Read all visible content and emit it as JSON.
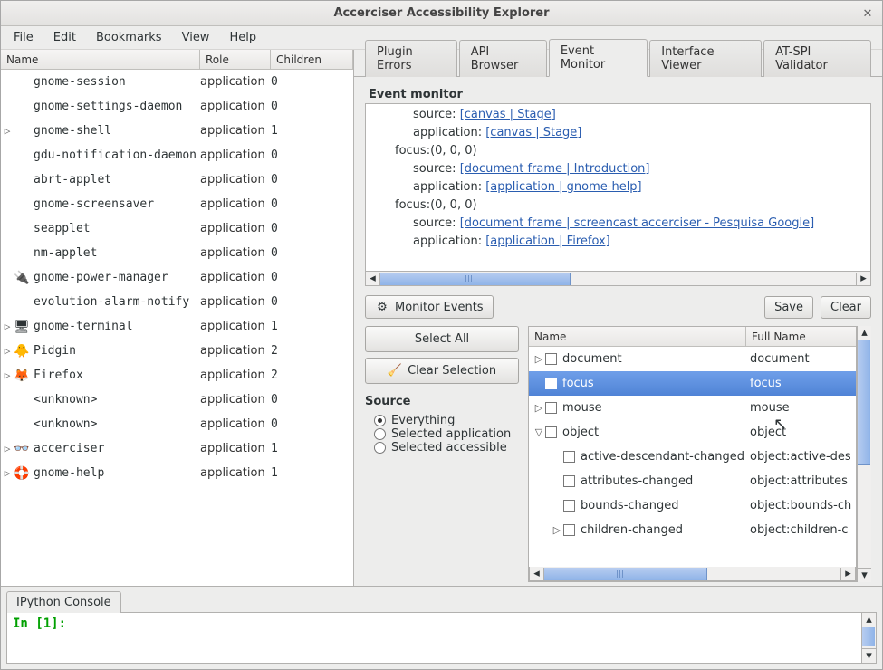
{
  "window": {
    "title": "Accerciser Accessibility Explorer"
  },
  "menubar": [
    "File",
    "Edit",
    "Bookmarks",
    "View",
    "Help"
  ],
  "left_tree": {
    "headers": {
      "name": "Name",
      "role": "Role",
      "children": "Children"
    },
    "rows": [
      {
        "exp": "",
        "icon": "",
        "name": "gnome-session",
        "role": "application",
        "children": "0"
      },
      {
        "exp": "",
        "icon": "",
        "name": "gnome-settings-daemon",
        "role": "application",
        "children": "0"
      },
      {
        "exp": "▷",
        "icon": "",
        "name": "gnome-shell",
        "role": "application",
        "children": "1"
      },
      {
        "exp": "",
        "icon": "",
        "name": "gdu-notification-daemon",
        "role": "application",
        "children": "0"
      },
      {
        "exp": "",
        "icon": "",
        "name": "abrt-applet",
        "role": "application",
        "children": "0"
      },
      {
        "exp": "",
        "icon": "",
        "name": "gnome-screensaver",
        "role": "application",
        "children": "0"
      },
      {
        "exp": "",
        "icon": "",
        "name": "seapplet",
        "role": "application",
        "children": "0"
      },
      {
        "exp": "",
        "icon": "",
        "name": "nm-applet",
        "role": "application",
        "children": "0"
      },
      {
        "exp": "",
        "icon": "🔌",
        "name": "gnome-power-manager",
        "role": "application",
        "children": "0"
      },
      {
        "exp": "",
        "icon": "",
        "name": "evolution-alarm-notify",
        "role": "application",
        "children": "0"
      },
      {
        "exp": "▷",
        "icon": "🖥",
        "name": "gnome-terminal",
        "role": "application",
        "children": "1"
      },
      {
        "exp": "▷",
        "icon": "🐥",
        "name": "Pidgin",
        "role": "application",
        "children": "2"
      },
      {
        "exp": "▷",
        "icon": "🦊",
        "name": "Firefox",
        "role": "application",
        "children": "2"
      },
      {
        "exp": "",
        "icon": "",
        "name": "<unknown>",
        "role": "application",
        "children": "0"
      },
      {
        "exp": "",
        "icon": "",
        "name": "<unknown>",
        "role": "application",
        "children": "0"
      },
      {
        "exp": "▷",
        "icon": "👓",
        "name": "accerciser",
        "role": "application",
        "children": "1"
      },
      {
        "exp": "▷",
        "icon": "🛟",
        "name": "gnome-help",
        "role": "application",
        "children": "1"
      }
    ]
  },
  "tabs": [
    "Plugin Errors",
    "API Browser",
    "Event Monitor",
    "Interface Viewer",
    "AT-SPI Validator"
  ],
  "active_tab": 2,
  "section_title": "Event monitor",
  "log": {
    "lines": [
      {
        "indent": 2,
        "prefix": "source: ",
        "link": "[canvas | Stage]"
      },
      {
        "indent": 2,
        "prefix": "application: ",
        "link": "[canvas | Stage]"
      },
      {
        "indent": 1,
        "prefix": "focus:(0, 0, 0)",
        "link": ""
      },
      {
        "indent": 2,
        "prefix": "source: ",
        "link": "[document frame | Introduction]"
      },
      {
        "indent": 2,
        "prefix": "application: ",
        "link": "[application | gnome-help]"
      },
      {
        "indent": 1,
        "prefix": "focus:(0, 0, 0)",
        "link": ""
      },
      {
        "indent": 2,
        "prefix": "source: ",
        "link": "[document frame | screencast accerciser - Pesquisa Google]"
      },
      {
        "indent": 2,
        "prefix": "application: ",
        "link": "[application | Firefox]"
      }
    ]
  },
  "buttons": {
    "monitor": "Monitor Events",
    "save": "Save",
    "clear": "Clear",
    "select_all": "Select All",
    "clear_selection": "Clear Selection"
  },
  "source": {
    "title": "Source",
    "options": [
      "Everything",
      "Selected application",
      "Selected accessible"
    ],
    "selected": 0
  },
  "event_tree": {
    "headers": {
      "name": "Name",
      "full": "Full Name"
    },
    "rows": [
      {
        "exp": "▷",
        "depth": 0,
        "checked": false,
        "name": "document",
        "full": "document",
        "sel": false
      },
      {
        "exp": "",
        "depth": 0,
        "checked": true,
        "name": "focus",
        "full": "focus",
        "sel": true
      },
      {
        "exp": "▷",
        "depth": 0,
        "checked": false,
        "name": "mouse",
        "full": "mouse",
        "sel": false
      },
      {
        "exp": "▽",
        "depth": 0,
        "checked": false,
        "name": "object",
        "full": "object",
        "sel": false
      },
      {
        "exp": "",
        "depth": 1,
        "checked": false,
        "name": "active-descendant-changed",
        "full": "object:active-des",
        "sel": false
      },
      {
        "exp": "",
        "depth": 1,
        "checked": false,
        "name": "attributes-changed",
        "full": "object:attributes",
        "sel": false
      },
      {
        "exp": "",
        "depth": 1,
        "checked": false,
        "name": "bounds-changed",
        "full": "object:bounds-ch",
        "sel": false
      },
      {
        "exp": "▷",
        "depth": 1,
        "checked": false,
        "name": "children-changed",
        "full": "object:children-c",
        "sel": false
      }
    ]
  },
  "console": {
    "tab": "IPython Console",
    "prompt": "In [1]:"
  }
}
